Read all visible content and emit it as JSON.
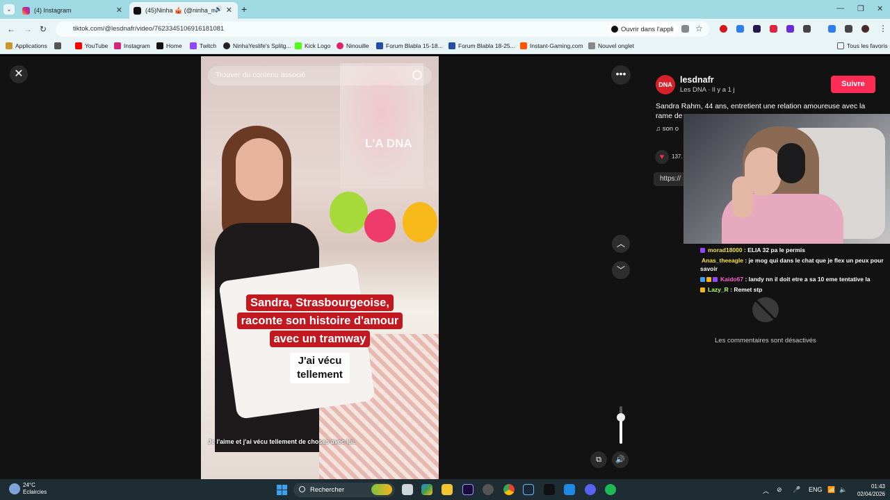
{
  "browser": {
    "tabs": [
      {
        "label": "(4) Instagram",
        "active": false
      },
      {
        "label": "(45)Ninha 🎪 (@ninha_mn",
        "active": true
      }
    ],
    "url": "tiktok.com/@lesdnafr/video/7623345106916181081",
    "open_in_app": "Ouvrir dans l'appli",
    "bookmarks": [
      "Applications",
      "YouTube",
      "Instagram",
      "Home",
      "Twitch",
      "NinhaYeslife's Splitg...",
      "Kick Logo",
      "Ninouille",
      "Forum Blabla 15-18...",
      "Forum Blabla 18-25...",
      "Instant-Gaming.com",
      "Nouvel onglet"
    ],
    "all_bookmarks": "Tous les favoris"
  },
  "video": {
    "search_placeholder": "Trouver du contenu associé",
    "watermark": "L'A DNA",
    "caption_lines": [
      "Sandra, Strasbourgeoise,",
      "raconte son histoire d'amour",
      "avec un tramway"
    ],
    "caption_white": "J'ai vécu tellement",
    "subtitle": "Je l'aime et j'ai vécu tellement de choses avec lui.",
    "volume_level": 0.7
  },
  "sidebar": {
    "avatar_text": "DNA",
    "username": "lesdnafr",
    "meta": "Les DNA · Il y a 1 j",
    "follow_label": "Suivre",
    "description": "Sandra Rahm, 44 ans, entretient une relation amoureuse avec la rame de",
    "music": "son o",
    "like_count": "137.",
    "link": "https://",
    "comments_disabled": "Les commentaires sont désactivés"
  },
  "chat": [
    {
      "user": "morad18000",
      "user_color": "#f4e04d",
      "message": "ELIA 32 pa le permis"
    },
    {
      "user": "Anas_theeagle",
      "user_color": "#f4e04d",
      "message": "je mog qui dans le chat que je flex un peux pour savoir"
    },
    {
      "user": "Kaido67",
      "user_color": "#ff5ec8",
      "message": "landy nn il doit etre a sa 10 eme tentative la"
    },
    {
      "user": "Lazy_R",
      "user_color": "#b6ff6b",
      "message": "Remet stp"
    }
  ],
  "taskbar": {
    "temperature": "24°C",
    "weather": "Eclaircies",
    "search": "Rechercher",
    "lang": "ENG",
    "time": "01:43",
    "date": "02/04/2026"
  },
  "colors": {
    "accent_follow": "#fe2c55",
    "brand_dna": "#d6202a",
    "caption_red": "#c2181f",
    "browser_frame": "#9fd9e2"
  }
}
